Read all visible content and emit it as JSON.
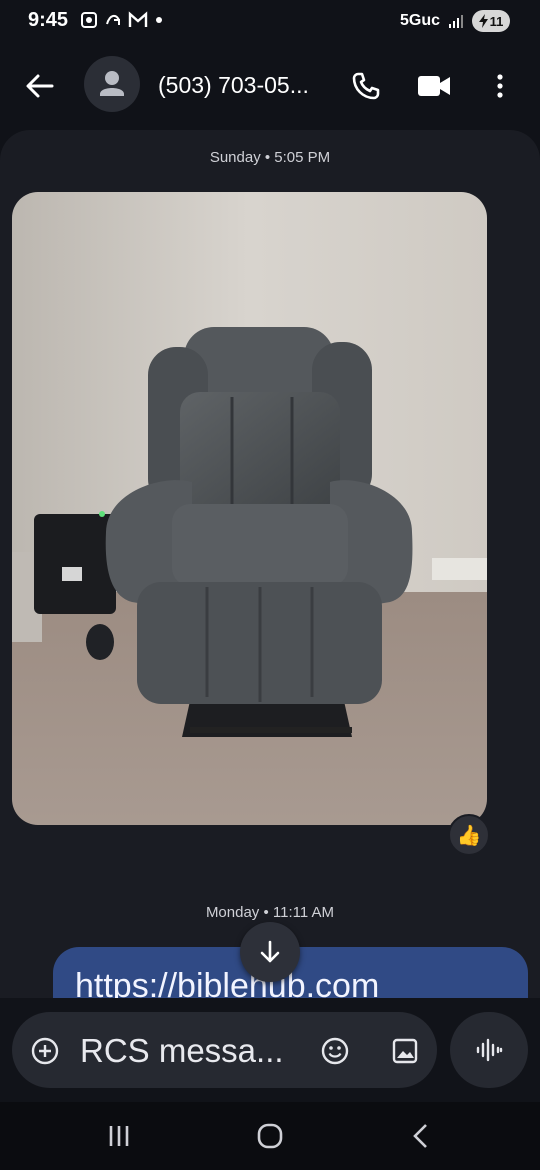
{
  "status_bar": {
    "time": "9:45",
    "network": "5Guc",
    "battery": "11",
    "icons": [
      "screenshot-icon",
      "link-icon",
      "gmail-icon",
      "dot-icon",
      "signal-icon",
      "battery-icon"
    ]
  },
  "header": {
    "contact": "(503) 703-05..."
  },
  "thread": {
    "stamp_1": "Sunday • 5:05 PM",
    "reaction": "👍",
    "stamp_2": "Monday • 11:11 AM",
    "link_text": "https://biblehub.com"
  },
  "compose": {
    "placeholder": "RCS messa..."
  },
  "colors": {
    "background": "#101218",
    "thread_bg": "#1a1c23",
    "bubble_sent": "#304a85",
    "pill": "#262931"
  }
}
